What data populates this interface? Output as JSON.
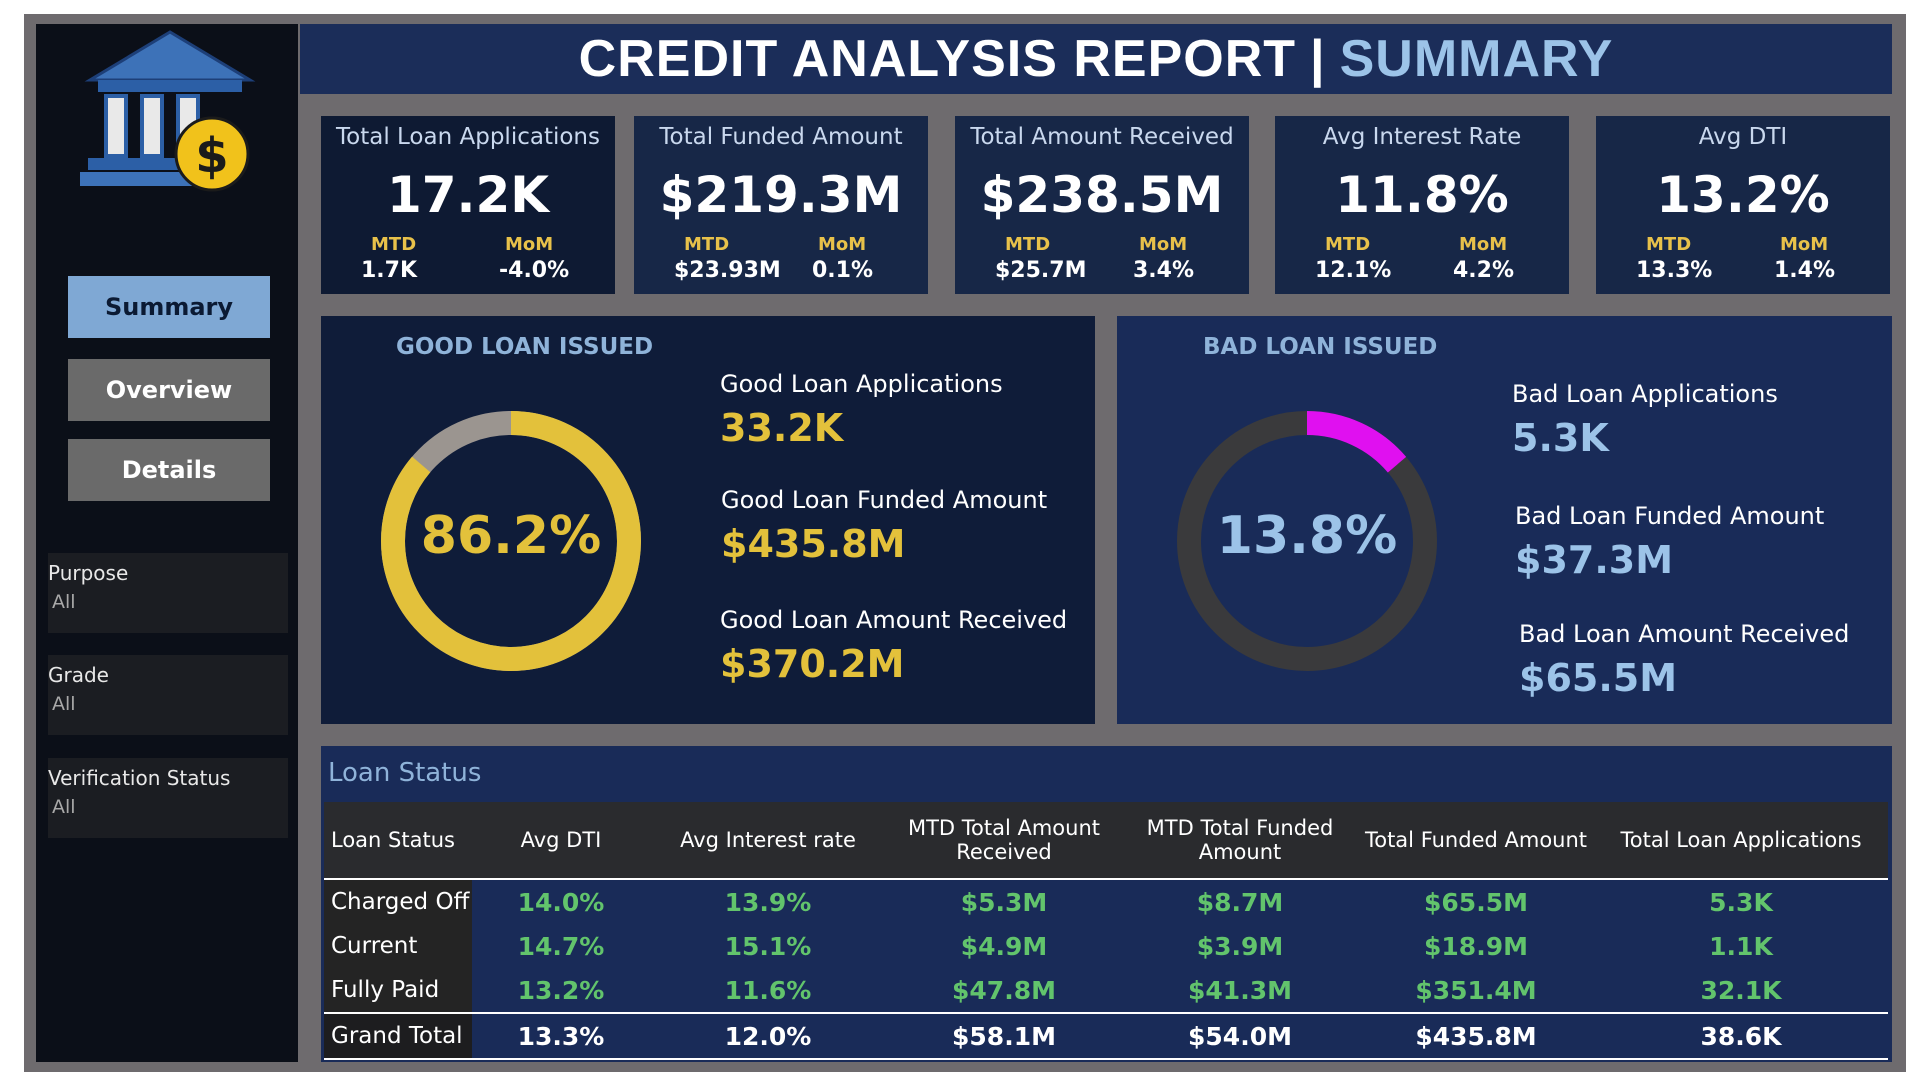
{
  "header": {
    "title": "CREDIT ANALYSIS REPORT",
    "separator": "|",
    "subtitle": "SUMMARY"
  },
  "sidebar": {
    "logo_icon": "bank-dollar-icon",
    "nav": {
      "summary": "Summary",
      "overview": "Overview",
      "details": "Details"
    },
    "filters": [
      {
        "label": "Purpose",
        "value": "All"
      },
      {
        "label": "Grade",
        "value": "All"
      },
      {
        "label": "Verification Status",
        "value": "All"
      }
    ]
  },
  "kpis": [
    {
      "title": "Total Loan Applications",
      "value": "17.2K",
      "mtd_label": "MTD",
      "mtd": "1.7K",
      "mom_label": "MoM",
      "mom": "-4.0%"
    },
    {
      "title": "Total Funded Amount",
      "value": "$219.3M",
      "mtd_label": "MTD",
      "mtd": "$23.93M",
      "mom_label": "MoM",
      "mom": "0.1%"
    },
    {
      "title": "Total Amount Received",
      "value": "$238.5M",
      "mtd_label": "MTD",
      "mtd": "$25.7M",
      "mom_label": "MoM",
      "mom": "3.4%"
    },
    {
      "title": "Avg Interest Rate",
      "value": "11.8%",
      "mtd_label": "MTD",
      "mtd": "12.1%",
      "mom_label": "MoM",
      "mom": "4.2%"
    },
    {
      "title": "Avg DTI",
      "value": "13.2%",
      "mtd_label": "MTD",
      "mtd": "13.3%",
      "mom_label": "MoM",
      "mom": "1.4%"
    }
  ],
  "good": {
    "title": "GOOD LOAN ISSUED",
    "percent": "86.2%",
    "percent_value": 86.2,
    "applications_label": "Good Loan Applications",
    "applications": "33.2K",
    "funded_label": "Good Loan Funded Amount",
    "funded": "$435.8M",
    "received_label": "Good Loan Amount Received",
    "received": "$370.2M"
  },
  "bad": {
    "title": "BAD LOAN ISSUED",
    "percent": "13.8%",
    "percent_value": 13.8,
    "applications_label": "Bad Loan Applications",
    "applications": "5.3K",
    "funded_label": "Bad Loan Funded Amount",
    "funded": "$37.3M",
    "received_label": "Bad Loan Amount Received",
    "received": "$65.5M"
  },
  "colors": {
    "good_accent": "#e3c13b",
    "good_track": "#9b9590",
    "bad_accent": "#e010f0",
    "bad_track": "#3a3a3c",
    "bad_text": "#9cc3e8",
    "table_value": "#62c46c"
  },
  "loan_status": {
    "title": "Loan Status",
    "columns": [
      "Loan Status",
      "Avg DTI",
      "Avg Interest rate",
      "MTD Total Amount Received",
      "MTD Total Funded Amount",
      "Total Funded Amount",
      "Total Loan Applications"
    ],
    "rows": [
      [
        "Charged Off",
        "14.0%",
        "13.9%",
        "$5.3M",
        "$8.7M",
        "$65.5M",
        "5.3K"
      ],
      [
        "Current",
        "14.7%",
        "15.1%",
        "$4.9M",
        "$3.9M",
        "$18.9M",
        "1.1K"
      ],
      [
        "Fully Paid",
        "13.2%",
        "11.6%",
        "$47.8M",
        "$41.3M",
        "$351.4M",
        "32.1K"
      ]
    ],
    "total": [
      "Grand Total",
      "13.3%",
      "12.0%",
      "$58.1M",
      "$54.0M",
      "$435.8M",
      "38.6K"
    ]
  }
}
